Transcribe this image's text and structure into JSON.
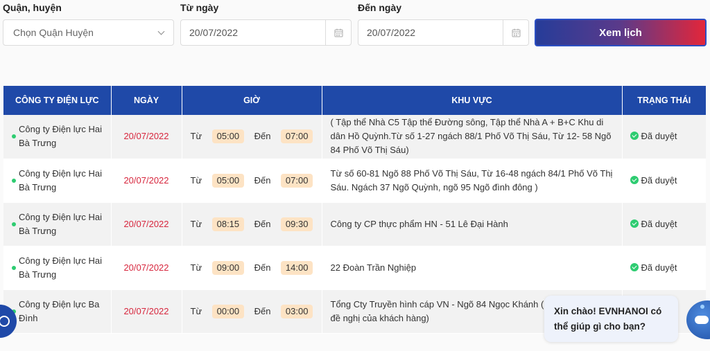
{
  "filters": {
    "district_label": "Quận, huyện",
    "district_value": "Chọn Quận Huyện",
    "from_label": "Từ ngày",
    "from_value": "20/07/2022",
    "to_label": "Đến ngày",
    "to_value": "20/07/2022",
    "submit_label": "Xem lịch"
  },
  "table": {
    "headers": [
      "CÔNG TY ĐIỆN LỰC",
      "NGÀY",
      "GIỜ",
      "KHU VỰC",
      "TRẠNG THÁI"
    ],
    "from_word": "Từ",
    "to_word": "Đến",
    "rows": [
      {
        "company": "Công ty Điện lực Hai Bà Trưng",
        "date": "20/07/2022",
        "start": "05:00",
        "end": "07:00",
        "area": "( Tập thể Nhà C5 Tập thể Đường sông, Tập thể Nhà A + B+C Khu di dân Hồ Quỳnh.Từ số 1-27 ngách 88/1 Phố Võ Thị Sáu, Từ 12- 58 Ngõ 84 Phố Võ Thị Sáu)",
        "status": "Đã duyệt"
      },
      {
        "company": "Công ty Điện lực Hai Bà Trưng",
        "date": "20/07/2022",
        "start": "05:00",
        "end": "07:00",
        "area": "Từ số 60-81 Ngõ 88 Phố Võ Thị Sáu, Từ 16-48 ngách 84/1 Phố Võ Thị Sáu. Ngách 37 Ngõ Quỳnh, ngõ 95 Ngõ đình đông )",
        "status": "Đã duyệt"
      },
      {
        "company": "Công ty Điện lực Hai Bà Trưng",
        "date": "20/07/2022",
        "start": "08:15",
        "end": "09:30",
        "area": "Công ty CP thực phẩm HN - 51 Lê Đại Hành",
        "status": "Đã duyệt"
      },
      {
        "company": "Công ty Điện lực Hai Bà Trưng",
        "date": "20/07/2022",
        "start": "09:00",
        "end": "14:00",
        "area": "22 Đoàn Trần Nghiệp",
        "status": "Đã duyệt"
      },
      {
        "company": "Công ty Điện lực Ba Đình",
        "date": "20/07/2022",
        "start": "00:00",
        "end": "03:00",
        "area": "Tổng Cty Truyền hình cáp VN - Ngõ 84 Ngọc Khánh (ng theo công văn đề nghị của khách hàng)",
        "status": ""
      }
    ]
  },
  "chat": {
    "message": "Xin chào! EVNHANOI có thể giúp gì cho bạn?"
  },
  "colors": {
    "header_bg": "#1f49a8",
    "date_text": "#d7263d",
    "time_pill": "#fde3c4",
    "status_green": "#2ecc71"
  }
}
